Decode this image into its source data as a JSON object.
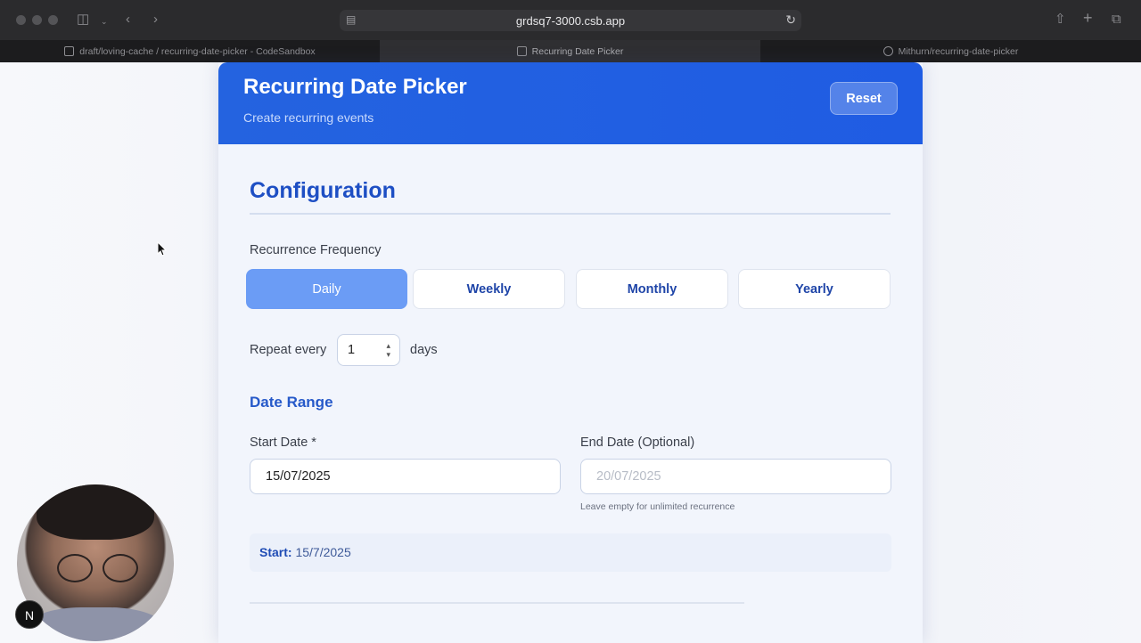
{
  "browser": {
    "url": "grdsq7-3000.csb.app",
    "tabs": [
      {
        "label": "draft/loving-cache / recurring-date-picker - CodeSandbox",
        "active": false
      },
      {
        "label": "Recurring Date Picker",
        "active": true
      },
      {
        "label": "Mithurn/recurring-date-picker",
        "active": false
      }
    ]
  },
  "header": {
    "title": "Recurring Date Picker",
    "subtitle": "Create recurring events",
    "reset_label": "Reset"
  },
  "configuration": {
    "title": "Configuration",
    "frequency_label": "Recurrence Frequency",
    "frequencies": [
      "Daily",
      "Weekly",
      "Monthly",
      "Yearly"
    ],
    "selected_frequency": "Daily",
    "repeat_label": "Repeat every",
    "repeat_value": "1",
    "repeat_unit": "days"
  },
  "date_range": {
    "title": "Date Range",
    "start_label": "Start Date *",
    "start_value": "15/07/2025",
    "end_label": "End Date (Optional)",
    "end_placeholder": "20/07/2025",
    "end_hint": "Leave empty for unlimited recurrence"
  },
  "summary": {
    "start_label": "Start:",
    "start_value": "15/7/2025"
  },
  "overlay": {
    "badge": "N"
  },
  "colors": {
    "header_blue": "#2463e0",
    "accent_blue": "#1e4fc4",
    "active_frequency": "#6b9cf5"
  }
}
